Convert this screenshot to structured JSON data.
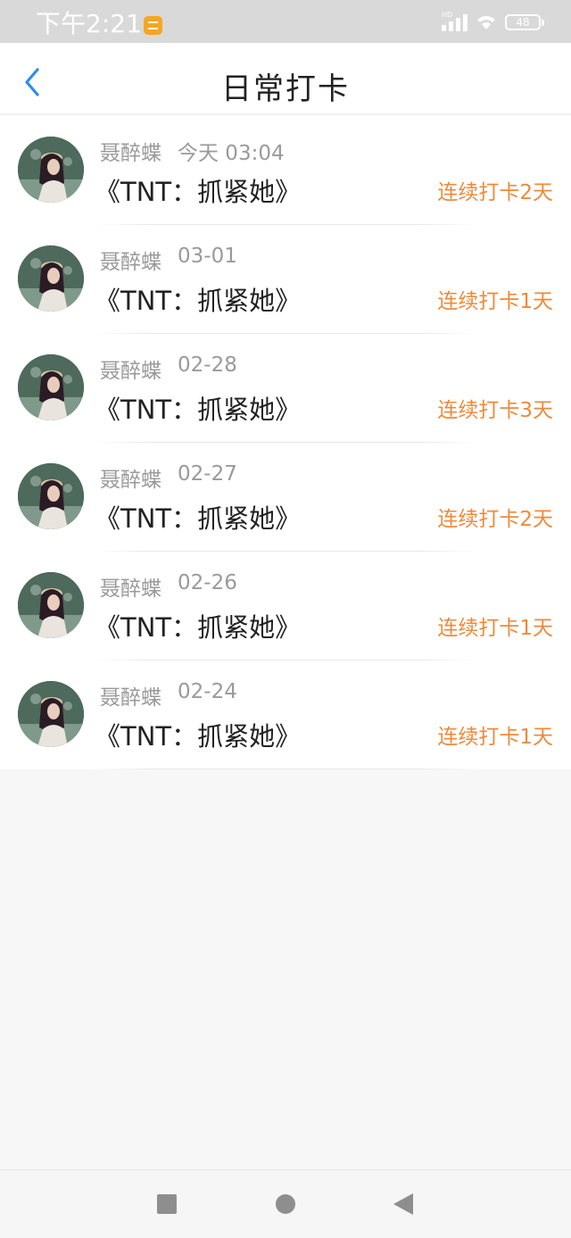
{
  "status_bar": {
    "time": "下午2:21",
    "network": "HD",
    "battery": "48"
  },
  "header": {
    "title": "日常打卡",
    "back_icon": "chevron-left-icon"
  },
  "colors": {
    "accent": "#ef8a3a",
    "back_arrow": "#2a8ef0",
    "meta_text": "#9a9a9a",
    "title_text": "#222222"
  },
  "checkins": [
    {
      "user": "聂醉蝶",
      "time": "今天 03:04",
      "book": "《TNT：抓紧她》",
      "streak": "连续打卡2天"
    },
    {
      "user": "聂醉蝶",
      "time": "03-01",
      "book": "《TNT：抓紧她》",
      "streak": "连续打卡1天"
    },
    {
      "user": "聂醉蝶",
      "time": "02-28",
      "book": "《TNT：抓紧她》",
      "streak": "连续打卡3天"
    },
    {
      "user": "聂醉蝶",
      "time": "02-27",
      "book": "《TNT：抓紧她》",
      "streak": "连续打卡2天"
    },
    {
      "user": "聂醉蝶",
      "time": "02-26",
      "book": "《TNT：抓紧她》",
      "streak": "连续打卡1天"
    },
    {
      "user": "聂醉蝶",
      "time": "02-24",
      "book": "《TNT：抓紧她》",
      "streak": "连续打卡1天"
    }
  ]
}
